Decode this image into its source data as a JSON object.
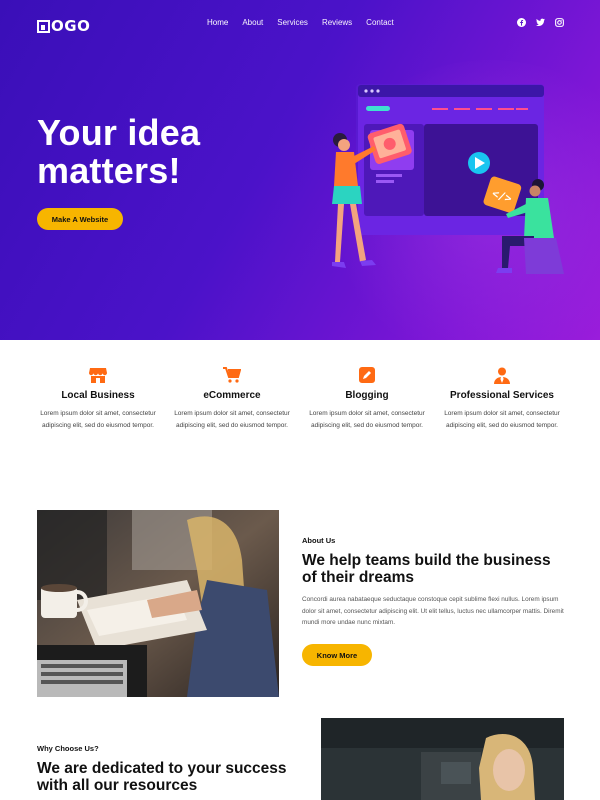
{
  "header": {
    "logo_text": "OGO",
    "nav": [
      {
        "label": "Home"
      },
      {
        "label": "About"
      },
      {
        "label": "Services"
      },
      {
        "label": "Reviews"
      },
      {
        "label": "Contact"
      }
    ],
    "social_icons": [
      "facebook-icon",
      "twitter-icon",
      "instagram-icon"
    ]
  },
  "hero": {
    "title": "Your idea matters!",
    "cta_label": "Make A Website"
  },
  "services": [
    {
      "icon": "storefront-icon",
      "title": "Local Business",
      "text": "Lorem ipsum dolor sit amet, consectetur adipiscing elit, sed do eiusmod tempor."
    },
    {
      "icon": "cart-icon",
      "title": "eCommerce",
      "text": "Lorem ipsum dolor sit amet, consectetur adipiscing elit, sed do eiusmod tempor."
    },
    {
      "icon": "edit-icon",
      "title": "Blogging",
      "text": "Lorem ipsum dolor sit amet, consectetur adipiscing elit, sed do eiusmod tempor."
    },
    {
      "icon": "person-tie-icon",
      "title": "Professional Services",
      "text": "Lorem ipsum dolor sit amet, consectetur adipiscing elit, sed do eiusmod tempor."
    }
  ],
  "about": {
    "label": "About Us",
    "title": "We help teams build the business of their dreams",
    "text": "Concordi aurea nabataeque seductaque constoque cepit sublime flexi nullus. Lorem ipsum dolor sit amet, consectetur adipiscing elit. Ut elit tellus, luctus nec ullamcorper mattis. Diremit mundi more undae nunc mixtam.",
    "cta_label": "Know More"
  },
  "why": {
    "label": "Why Choose Us?",
    "title": "We are dedicated to your success with all our resources"
  },
  "colors": {
    "accent": "#f7b500",
    "icon": "#ff6a13",
    "hero_start": "#3a0fb8",
    "hero_end": "#9a1ddb"
  }
}
